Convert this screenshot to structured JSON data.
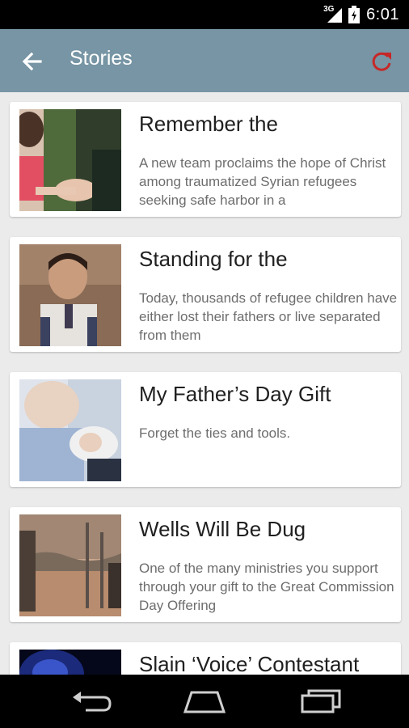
{
  "status_bar": {
    "network": "3G",
    "time": "6:01"
  },
  "app_bar": {
    "title": "Stories",
    "back_icon": "arrow-left-icon",
    "refresh_icon": "refresh-icon",
    "refresh_color": "#c62828"
  },
  "stories": [
    {
      "title": "Remember the",
      "summary": "A new team proclaims the hope of Christ among traumatized Syrian refugees seeking safe harbor in a",
      "image": "photo-woman-holding-child-hand"
    },
    {
      "title": "Standing for the",
      "summary": "Today, thousands of refugee children have either lost their fathers or live separated from them",
      "image": "photo-refugee-boy"
    },
    {
      "title": "My Father’s Day Gift",
      "summary": "Forget the ties and tools.",
      "image": "photo-father-with-baby"
    },
    {
      "title": "Wells Will Be Dug",
      "summary": "One of the many ministries you support through your gift to the Great Commission Day Offering",
      "image": "photo-dry-landscape-well"
    },
    {
      "title": "Slain ‘Voice’ Contestant",
      "summary": "",
      "image": "photo-dark-blue-stage"
    }
  ],
  "nav_bar": {
    "back_icon": "nav-back-icon",
    "home_icon": "nav-home-icon",
    "recents_icon": "nav-recents-icon"
  },
  "colors": {
    "app_bar": "#7795a4",
    "background": "#ebebeb",
    "card": "#ffffff"
  }
}
